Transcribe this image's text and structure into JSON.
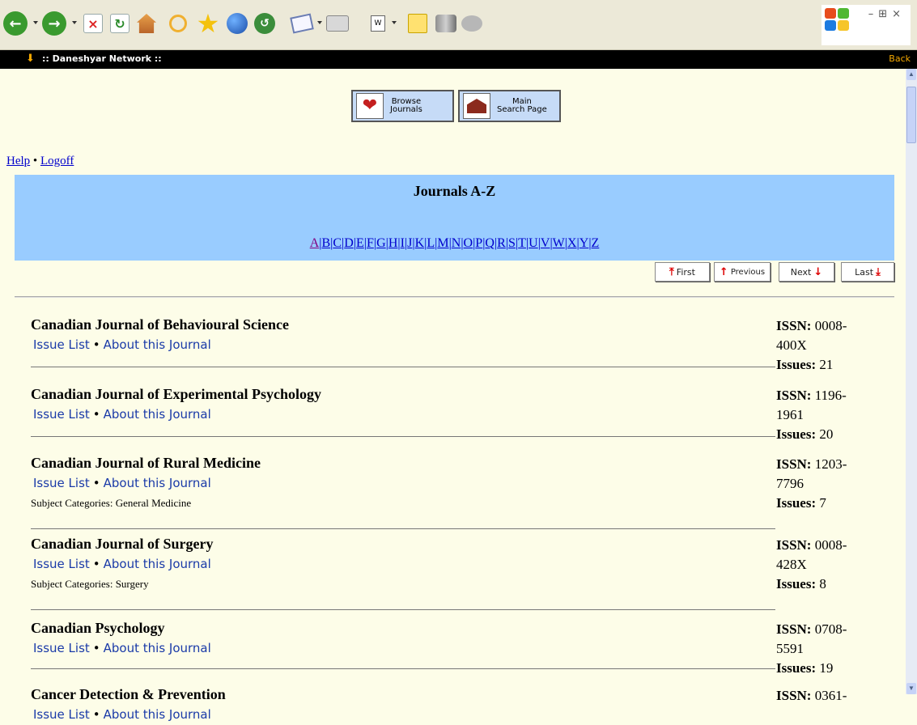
{
  "titlebar": {
    "name": ":: Daneshyar Network ::",
    "back": "Back"
  },
  "nav": {
    "browse_label": "Browse\nJournals",
    "main_label": "Main\nSearch Page"
  },
  "links": {
    "help": "Help",
    "sep": "•",
    "logoff": "Logoff"
  },
  "band": {
    "heading": "Journals A-Z"
  },
  "alphabet": [
    "A",
    "B",
    "C",
    "D",
    "E",
    "F",
    "G",
    "H",
    "I",
    "J",
    "K",
    "L",
    "M",
    "N",
    "O",
    "P",
    "Q",
    "R",
    "S",
    "T",
    "U",
    "V",
    "W",
    "X",
    "Y",
    "Z"
  ],
  "pager": {
    "first": "First",
    "previous": "Previous",
    "next": "Next",
    "last": "Last"
  },
  "journal_labels": {
    "issue_list": "Issue List",
    "about": "About this Journal",
    "issn": "ISSN:",
    "issues": "Issues:"
  },
  "journals": [
    {
      "title": "Canadian Journal of Behavioural Science",
      "issn_a": "0008-",
      "issn_b": "400X",
      "issues": "21",
      "subject": ""
    },
    {
      "title": "Canadian Journal of Experimental Psychology",
      "issn_a": "1196-",
      "issn_b": "1961",
      "issues": "20",
      "subject": ""
    },
    {
      "title": "Canadian Journal of Rural Medicine",
      "issn_a": "1203-",
      "issn_b": "7796",
      "issues": "7",
      "subject": "Subject Categories: General Medicine"
    },
    {
      "title": "Canadian Journal of Surgery",
      "issn_a": "0008-",
      "issn_b": "428X",
      "issues": "8",
      "subject": "Subject Categories: Surgery"
    },
    {
      "title": "Canadian Psychology",
      "issn_a": "0708-",
      "issn_b": "5591",
      "issues": "19",
      "subject": ""
    },
    {
      "title": "Cancer Detection & Prevention",
      "issn_a": "0361-",
      "issn_b": "",
      "issues": "",
      "subject": ""
    }
  ],
  "colors": {
    "band": "#99ccff",
    "page_bg": "#fdfde8",
    "link": "#0000cc",
    "visited": "#800080"
  }
}
